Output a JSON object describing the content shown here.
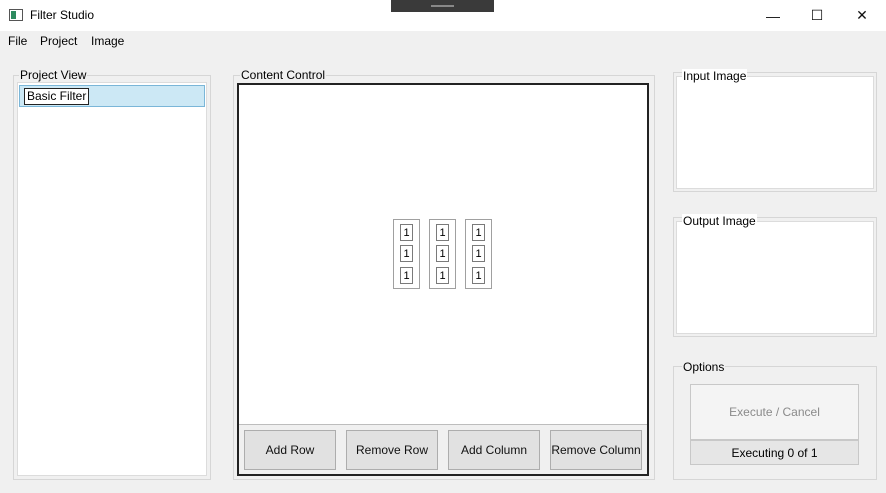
{
  "window": {
    "title": "Filter Studio",
    "minimize": "—",
    "maximize": "☐",
    "close": "✕"
  },
  "menu": [
    "File",
    "Project",
    "Image"
  ],
  "project_view": {
    "label": "Project View",
    "items": [
      "Basic Filter"
    ]
  },
  "content_control": {
    "label": "Content Control",
    "matrix": [
      [
        "1",
        "1",
        "1"
      ],
      [
        "1",
        "1",
        "1"
      ],
      [
        "1",
        "1",
        "1"
      ]
    ],
    "buttons": [
      "Add Row",
      "Remove Row",
      "Add Column",
      "Remove Column"
    ]
  },
  "input_image": {
    "label": "Input Image"
  },
  "output_image": {
    "label": "Output Image"
  },
  "options": {
    "label": "Options",
    "execute_label": "Execute / Cancel",
    "status": "Executing 0 of 1"
  }
}
